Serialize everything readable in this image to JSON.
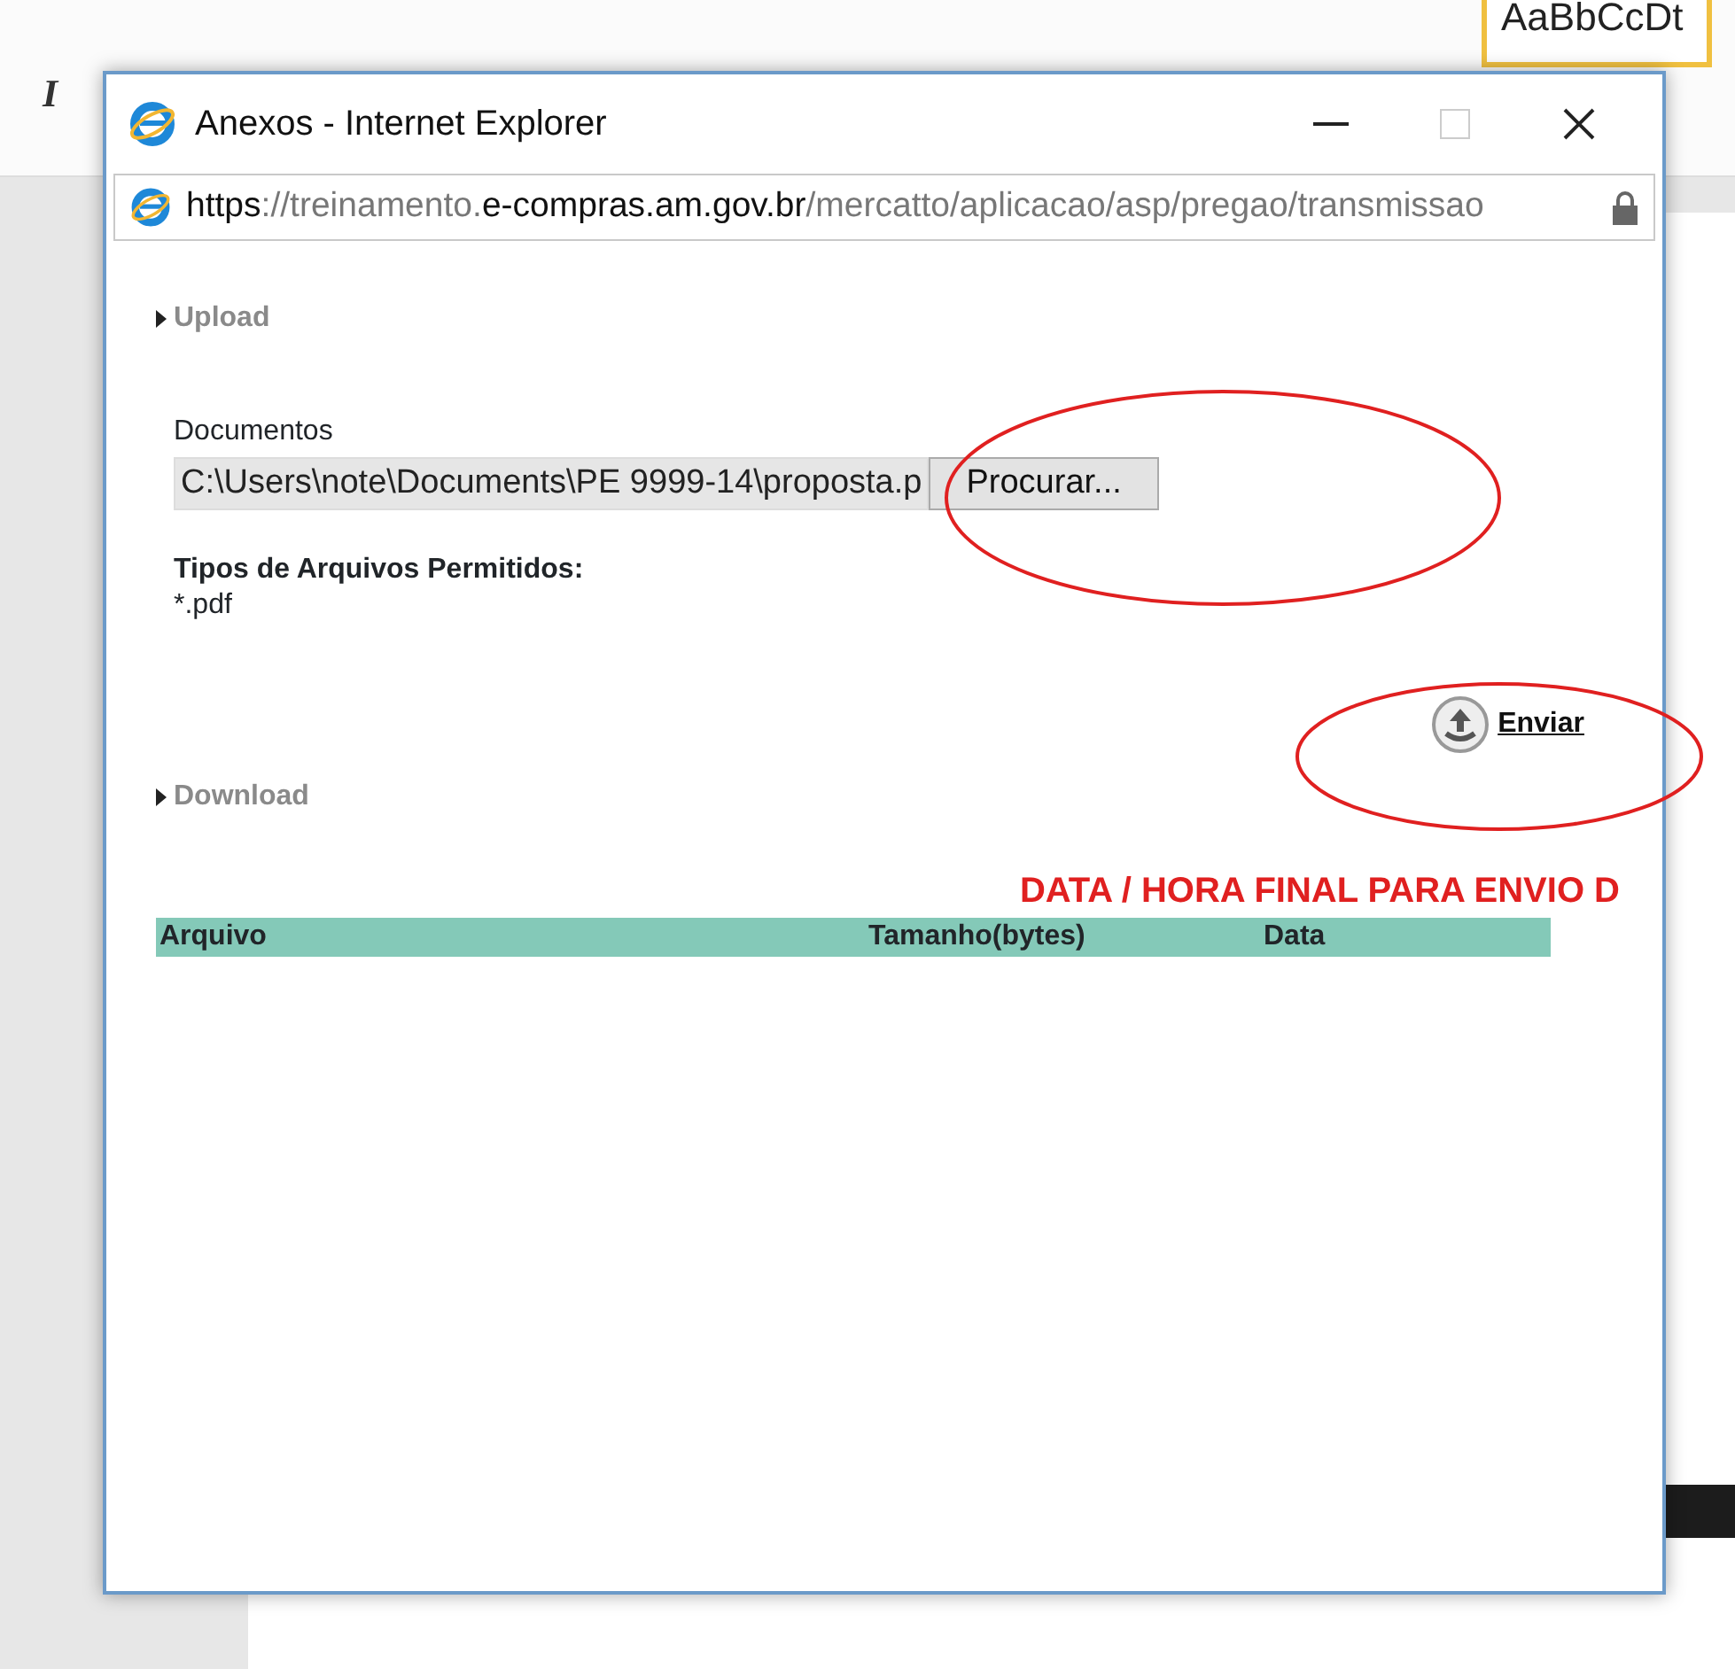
{
  "background_app": {
    "toolbar_button": "I",
    "style_preview": "AaBbCcDt"
  },
  "window": {
    "title": "Anexos - Internet Explorer",
    "address": [
      {
        "text": "https",
        "dark": true
      },
      {
        "text": "://treinamento.",
        "dark": false
      },
      {
        "text": "e-compras.am.gov.br",
        "dark": true
      },
      {
        "text": "/mercatto/aplicacao/asp/pregao/transmissao",
        "dark": false
      }
    ]
  },
  "upload": {
    "label": "Upload",
    "field_label": "Documentos",
    "file_value": "C:\\Users\\note\\Documents\\PE 9999-14\\proposta.p",
    "browse_button": "Procurar...",
    "allowed_label": "Tipos de Arquivos Permitidos:",
    "allowed_types": "*.pdf",
    "send_link": "Enviar"
  },
  "download": {
    "label": "Download",
    "deadline": "DATA / HORA FINAL PARA ENVIO D",
    "columns": [
      "Arquivo",
      "Tamanho(bytes)",
      "Data"
    ]
  }
}
